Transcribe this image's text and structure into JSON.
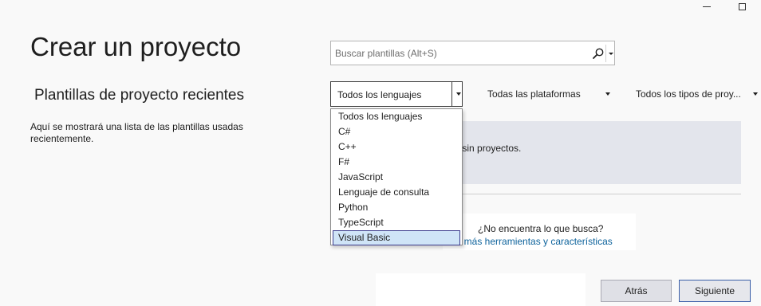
{
  "window": {
    "minimize_icon": "minimize-icon",
    "maximize_icon": "maximize-icon"
  },
  "page": {
    "title": "Crear un proyecto"
  },
  "recent": {
    "heading": "Plantillas de proyecto recientes",
    "description": "Aquí se mostrará una lista de las plantillas usadas recientemente."
  },
  "search": {
    "placeholder": "Buscar plantillas (Alt+S)",
    "icon": "search-icon"
  },
  "filters": {
    "language": "Todos los lenguajes",
    "platform": "Todas las plataformas",
    "project_type": "Todos los tipos de proy..."
  },
  "language_dropdown": {
    "items": [
      "Todos los lenguajes",
      "C#",
      "C++",
      "F#",
      "JavaScript",
      "Lenguaje de consulta",
      "Python",
      "TypeScript",
      "Visual Basic"
    ],
    "highlighted": "Visual Basic"
  },
  "templates": {
    "partial_message": "cía sin proyectos."
  },
  "help": {
    "question": "¿No encuentra lo que busca?",
    "link": "talar más herramientas y características"
  },
  "buttons": {
    "back": "Atrás",
    "next": "Siguiente"
  },
  "colors": {
    "accent_border": "#3a5ea8",
    "link": "#0e639c",
    "selection": "#cfe4f7",
    "panel": "#e3e5ec"
  }
}
